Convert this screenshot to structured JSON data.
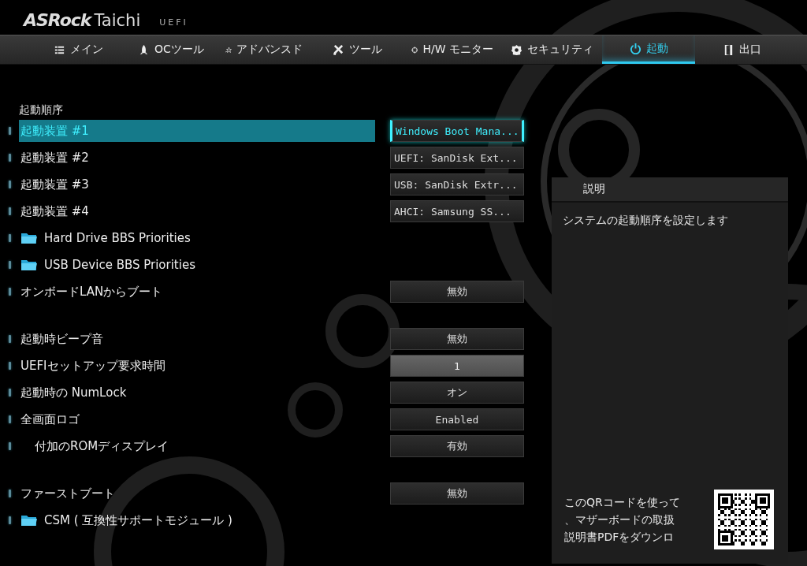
{
  "header": {
    "brand": "ASRock",
    "model": "Taichi",
    "firmware": "UEFI"
  },
  "tabs": [
    {
      "label": "メイン",
      "selected": false
    },
    {
      "label": "OCツール",
      "selected": false
    },
    {
      "label": "アドバンスド",
      "selected": false
    },
    {
      "label": "ツール",
      "selected": false
    },
    {
      "label": "H/W モニター",
      "selected": false
    },
    {
      "label": "セキュリティ",
      "selected": false
    },
    {
      "label": "起動",
      "selected": true
    },
    {
      "label": "出口",
      "selected": false
    }
  ],
  "sections": [
    {
      "heading": "起動順序",
      "items": [
        {
          "kind": "setting",
          "label": "起動装置 #1",
          "selected": true,
          "value": "Windows Boot Mana..."
        },
        {
          "kind": "setting",
          "label": "起動装置 #2",
          "selected": false,
          "value": "UEFI: SanDisk Ext..."
        },
        {
          "kind": "setting",
          "label": "起動装置 #3",
          "selected": false,
          "value": "USB: SanDisk Extr..."
        },
        {
          "kind": "setting",
          "label": "起動装置 #4",
          "selected": false,
          "value": "AHCI:  Samsung SS..."
        },
        {
          "kind": "folder",
          "label": "Hard Drive BBS Priorities",
          "selected": false
        },
        {
          "kind": "folder",
          "label": "USB Device BBS Priorities",
          "selected": false
        },
        {
          "kind": "setting",
          "label": "オンボードLANからブート",
          "selected": false,
          "value": "無効"
        }
      ]
    },
    {
      "items": [
        {
          "kind": "setting",
          "label": "起動時ビープ音",
          "selected": false,
          "value": "無効"
        },
        {
          "kind": "number",
          "label": "UEFIセットアップ要求時間",
          "selected": false,
          "value": "1"
        },
        {
          "kind": "setting",
          "label": "起動時の NumLock",
          "selected": false,
          "value": "オン"
        },
        {
          "kind": "setting",
          "label": "全画面ロゴ",
          "selected": false,
          "value": "Enabled",
          "children": [
            {
              "kind": "setting",
              "label": "付加のROMディスプレイ",
              "selected": false,
              "value": "有効"
            }
          ]
        }
      ]
    },
    {
      "items": [
        {
          "kind": "setting",
          "label": "ファーストブート",
          "selected": false,
          "value": "無効"
        },
        {
          "kind": "folder",
          "label": "CSM ( 互換性サポートモジュール )",
          "selected": false
        }
      ]
    }
  ],
  "description": {
    "title": "説明",
    "text": "システムの起動順序を設定します",
    "qr_text": "このQRコードを使って、マザーボードの取扱説明書PDFをダウンロ"
  }
}
